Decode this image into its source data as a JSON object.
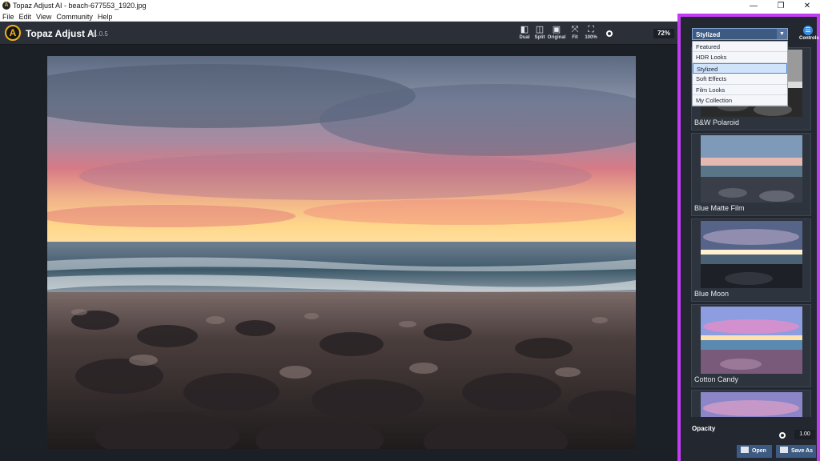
{
  "window": {
    "title": "Topaz Adjust AI - beach-677553_1920.jpg",
    "icon_letter": "A",
    "minimize": "—",
    "maximize": "❐",
    "close": "✕"
  },
  "menu": {
    "file": "File",
    "edit": "Edit",
    "view": "View",
    "community": "Community",
    "help": "Help"
  },
  "header": {
    "logo_letter": "A",
    "app_name": "Topaz Adjust AI",
    "version": "v1.0.5"
  },
  "toolbar": {
    "dual": "Dual",
    "split": "Split",
    "original": "Original",
    "fit": "Fit",
    "actual": "100%",
    "zoom_value": "72%"
  },
  "sidebar": {
    "category_selected": "Stylized",
    "controls_label": "Controls",
    "categories": [
      "Featured",
      "HDR Looks",
      "Stylized",
      "Soft Effects",
      "Film Looks",
      "My Collection"
    ],
    "looks": [
      "B&W Polaroid",
      "Blue Matte Film",
      "Blue Moon",
      "Cotton Candy"
    ],
    "opacity_label": "Opacity",
    "opacity_value": "1.00",
    "open_label": "Open",
    "save_as_label": "Save As"
  },
  "colors": {
    "highlight": "#c23df2",
    "accent": "#3c5a82",
    "panel": "#232830"
  }
}
